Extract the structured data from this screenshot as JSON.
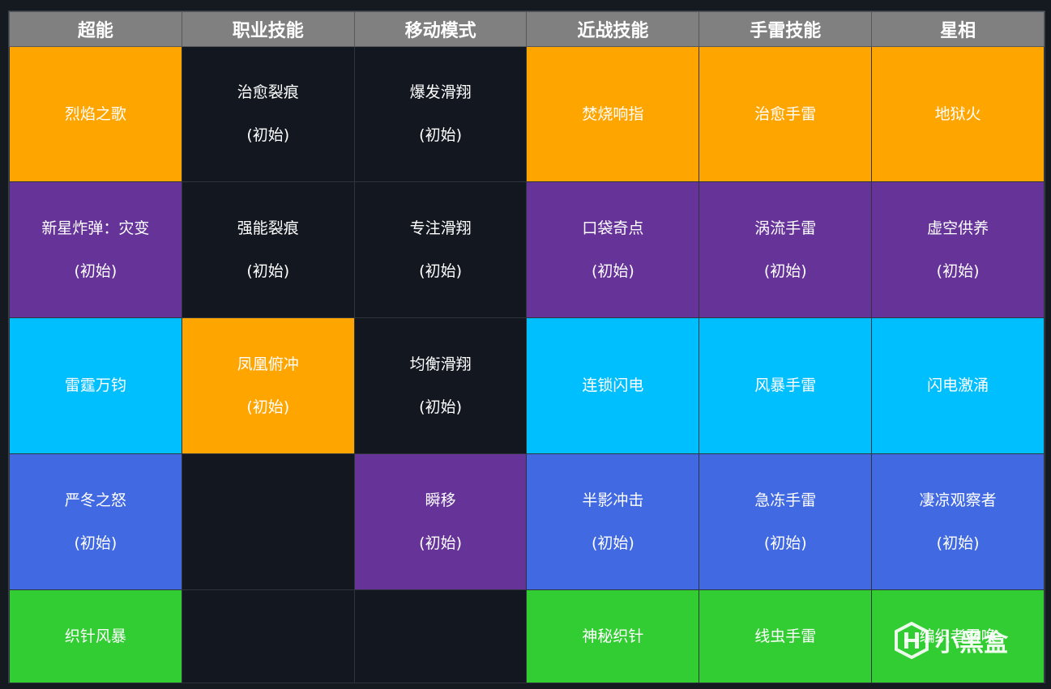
{
  "colors": {
    "orange": "#FFA500",
    "dark": "#131820",
    "purple": "#663399",
    "cyan": "#00BFFF",
    "blue": "#4169E1",
    "green": "#32CD32",
    "header": "#808080"
  },
  "headers": [
    "超能",
    "职业技能",
    "移动模式",
    "近战技能",
    "手雷技能",
    "星相"
  ],
  "rows": [
    [
      {
        "name": "烈焰之歌",
        "sub": "",
        "color": "orange"
      },
      {
        "name": "治愈裂痕",
        "sub": "(初始)",
        "color": "dark"
      },
      {
        "name": "爆发滑翔",
        "sub": "(初始)",
        "color": "dark"
      },
      {
        "name": "焚烧响指",
        "sub": "",
        "color": "orange"
      },
      {
        "name": "治愈手雷",
        "sub": "",
        "color": "orange"
      },
      {
        "name": "地狱火",
        "sub": "",
        "color": "orange"
      }
    ],
    [
      {
        "name": "新星炸弹：灾变",
        "sub": "(初始)",
        "color": "purple"
      },
      {
        "name": "强能裂痕",
        "sub": "(初始)",
        "color": "dark"
      },
      {
        "name": "专注滑翔",
        "sub": "(初始)",
        "color": "dark"
      },
      {
        "name": "口袋奇点",
        "sub": "(初始)",
        "color": "purple"
      },
      {
        "name": "涡流手雷",
        "sub": "(初始)",
        "color": "purple"
      },
      {
        "name": "虚空供养",
        "sub": "(初始)",
        "color": "purple"
      }
    ],
    [
      {
        "name": "雷霆万钧",
        "sub": "",
        "color": "cyan"
      },
      {
        "name": "凤凰俯冲",
        "sub": "(初始)",
        "color": "orange"
      },
      {
        "name": "均衡滑翔",
        "sub": "(初始)",
        "color": "dark"
      },
      {
        "name": "连锁闪电",
        "sub": "",
        "color": "cyan"
      },
      {
        "name": "风暴手雷",
        "sub": "",
        "color": "cyan"
      },
      {
        "name": "闪电激涌",
        "sub": "",
        "color": "cyan"
      }
    ],
    [
      {
        "name": "严冬之怒",
        "sub": "(初始)",
        "color": "blue"
      },
      {
        "name": "",
        "sub": "",
        "color": "dark"
      },
      {
        "name": "瞬移",
        "sub": "(初始)",
        "color": "purple"
      },
      {
        "name": "半影冲击",
        "sub": "(初始)",
        "color": "blue"
      },
      {
        "name": "急冻手雷",
        "sub": "(初始)",
        "color": "blue"
      },
      {
        "name": "凄凉观察者",
        "sub": "(初始)",
        "color": "blue"
      }
    ],
    [
      {
        "name": "织针风暴",
        "sub": "",
        "color": "green"
      },
      {
        "name": "",
        "sub": "",
        "color": "dark"
      },
      {
        "name": "",
        "sub": "",
        "color": "dark"
      },
      {
        "name": "神秘织针",
        "sub": "",
        "color": "green"
      },
      {
        "name": "线虫手雷",
        "sub": "",
        "color": "green"
      },
      {
        "name": "编织者召唤",
        "sub": "",
        "color": "green"
      }
    ]
  ],
  "watermark": {
    "text": "小黑盒",
    "icon": "heybox-logo-icon"
  }
}
